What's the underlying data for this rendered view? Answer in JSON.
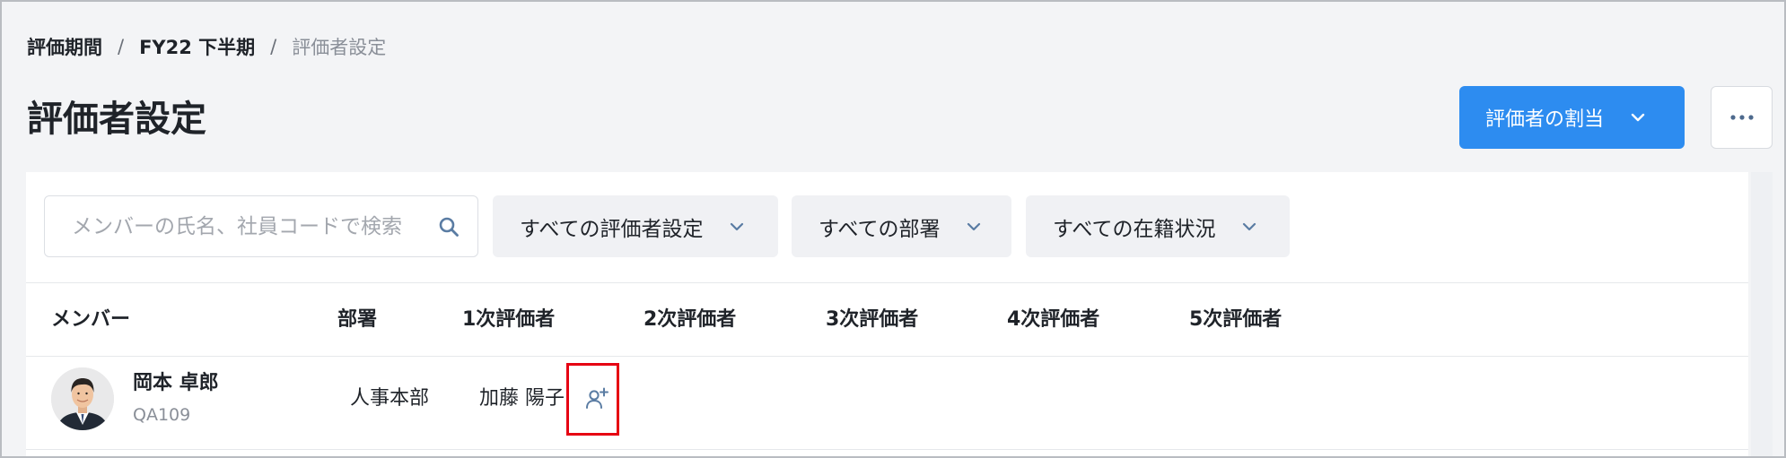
{
  "breadcrumb": {
    "items": [
      "評価期間",
      "FY22 下半期",
      "評価者設定"
    ],
    "separator": "/"
  },
  "page_title": "評価者設定",
  "actions": {
    "assign_label": "評価者の割当",
    "assign_icon": "chevron-down-icon",
    "more_icon": "more-horizontal-icon"
  },
  "filters": {
    "search_placeholder": "メンバーの氏名、社員コードで検索",
    "search_icon": "search-icon",
    "evaluator_setting": "すべての評価者設定",
    "department": "すべての部署",
    "employment_status": "すべての在籍状況"
  },
  "table": {
    "columns": [
      "メンバー",
      "部署",
      "1次評価者",
      "2次評価者",
      "3次評価者",
      "4次評価者",
      "5次評価者"
    ],
    "rows": [
      {
        "name": "岡本 卓郎",
        "code": "QA109",
        "department": "人事本部",
        "evaluator_1": "加藤 陽子",
        "add_icon": "add-person-icon"
      }
    ]
  },
  "colors": {
    "primary": "#2d8cf0",
    "page_background": "#f3f4f6",
    "highlight": "#e60012",
    "icon": "#5a7ca3"
  }
}
